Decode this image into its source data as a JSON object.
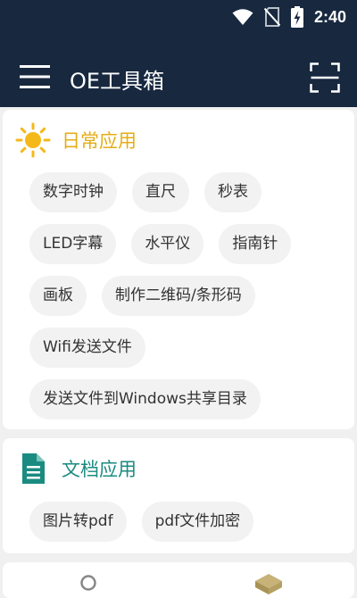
{
  "status_bar": {
    "time": "2:40",
    "icons": [
      "wifi-icon",
      "no-sim-icon",
      "battery-charging-icon"
    ]
  },
  "app_bar": {
    "title": "OE工具箱",
    "icons": [
      "menu-icon",
      "scan-icon"
    ]
  },
  "sections": [
    {
      "title": "日常应用",
      "icon": "sun-icon",
      "color": "#e4ad16",
      "rows": [
        [
          "数字时钟",
          "直尺",
          "秒表"
        ],
        [
          "LED字幕",
          "水平仪",
          "指南针"
        ],
        [
          "画板",
          "制作二维码/条形码"
        ],
        [
          "Wifi发送文件"
        ],
        [
          "发送文件到Windows共享目录"
        ]
      ]
    },
    {
      "title": "文档应用",
      "icon": "document-icon",
      "color": "#1a8b80",
      "rows": [
        [
          "图片转pdf",
          "pdf文件加密"
        ]
      ]
    }
  ],
  "bottom_nav": {
    "icons": [
      "search-icon",
      "box-icon"
    ]
  },
  "colors": {
    "header_bg": "#17283f",
    "page_bg": "#f0f0f0",
    "chip_bg": "#f2f2f2"
  }
}
